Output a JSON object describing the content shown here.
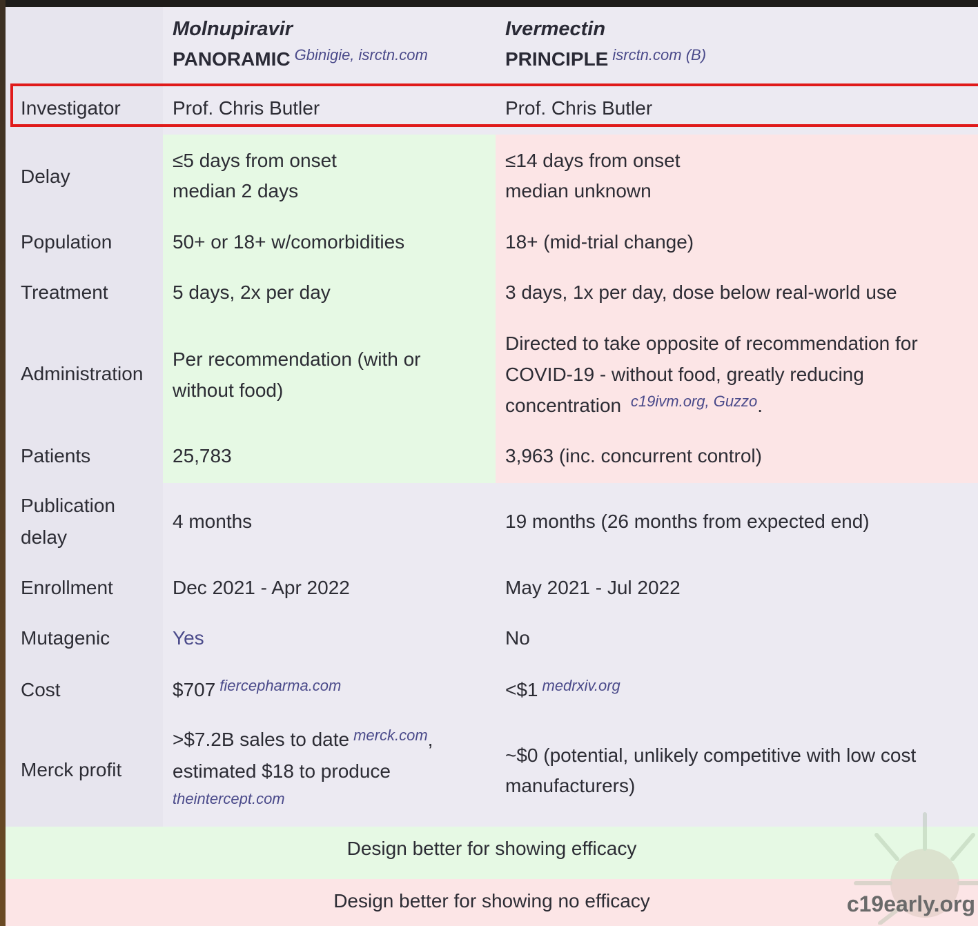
{
  "header": {
    "col1_drug": "Molnupiravir",
    "col1_trial": "PANORAMIC",
    "col1_cite": "Gbinigie, isrctn.com",
    "col2_drug": "Ivermectin",
    "col2_trial": "PRINCIPLE",
    "col2_cite": "isrctn.com (B)"
  },
  "rows": {
    "investigator": {
      "label": "Investigator",
      "a": "Prof. Chris Butler",
      "b": "Prof. Chris Butler"
    },
    "delay": {
      "label": "Delay",
      "a1": "≤5 days from onset",
      "a2": "median 2 days",
      "b1": "≤14 days from onset",
      "b2": "median unknown"
    },
    "population": {
      "label": "Population",
      "a": "50+ or 18+ w/comorbidities",
      "b": "18+ (mid-trial change)"
    },
    "treatment": {
      "label": "Treatment",
      "a": "5 days, 2x per day",
      "b": "3 days, 1x per day, dose below real-world use"
    },
    "administration": {
      "label": "Administration",
      "a1": "Per recommendation (with or",
      "a2": "without food)",
      "b1": "Directed to take opposite of recommendation for",
      "b2": "COVID-19 - without food, greatly reducing",
      "b3": "concentration",
      "b3_cite": "c19ivm.org, Guzzo",
      "b3_end": "."
    },
    "patients": {
      "label": "Patients",
      "a": "25,783",
      "b": "3,963 (inc. concurrent control)"
    },
    "publication_delay": {
      "label1": "Publication",
      "label2": "delay",
      "a": "4 months",
      "b": "19 months (26 months from expected end)"
    },
    "enrollment": {
      "label": "Enrollment",
      "a": "Dec 2021 - Apr 2022",
      "b": "May 2021 - Jul 2022"
    },
    "mutagenic": {
      "label": "Mutagenic",
      "a": "Yes",
      "b": "No"
    },
    "cost": {
      "label": "Cost",
      "a": "$707",
      "a_cite": "fiercepharma.com",
      "b": "<$1",
      "b_cite": "medrxiv.org"
    },
    "merck_profit": {
      "label": "Merck profit",
      "a1": ">$7.2B sales to date",
      "a1_cite": "merck.com",
      "a1_end": ",",
      "a2": "estimated $18 to produce",
      "a3_cite": "theintercept.com",
      "b1": "~$0 (potential, unlikely competitive with low cost",
      "b2": "manufacturers)"
    }
  },
  "legend": {
    "green": "Design better for showing efficacy",
    "red": "Design better for showing no efficacy"
  },
  "brand": "c19early.org",
  "colors": {
    "green": "#e6f9e4",
    "red": "#fce5e6",
    "highlight": "#e01a1a",
    "cite": "#4a4a8a"
  }
}
